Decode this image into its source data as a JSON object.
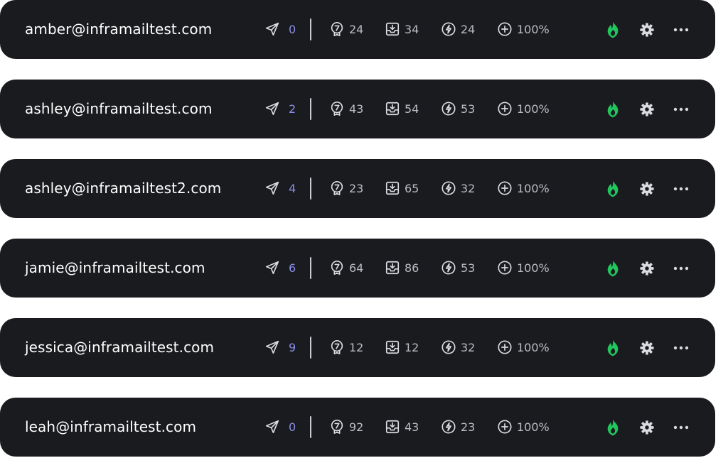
{
  "accounts": [
    {
      "email": "amber@inframailtest.com",
      "sent": "0",
      "ratings": "24",
      "inbox": "34",
      "activity": "24",
      "health": "100%",
      "warmup_status": "active"
    },
    {
      "email": "ashley@inframailtest.com",
      "sent": "2",
      "ratings": "43",
      "inbox": "54",
      "activity": "53",
      "health": "100%",
      "warmup_status": "active"
    },
    {
      "email": "ashley@inframailtest2.com",
      "sent": "4",
      "ratings": "23",
      "inbox": "65",
      "activity": "32",
      "health": "100%",
      "warmup_status": "active"
    },
    {
      "email": "jamie@inframailtest.com",
      "sent": "6",
      "ratings": "64",
      "inbox": "86",
      "activity": "53",
      "health": "100%",
      "warmup_status": "active"
    },
    {
      "email": "jessica@inframailtest.com",
      "sent": "9",
      "ratings": "12",
      "inbox": "12",
      "activity": "32",
      "health": "100%",
      "warmup_status": "active"
    },
    {
      "email": "leah@inframailtest.com",
      "sent": "0",
      "ratings": "92",
      "inbox": "43",
      "activity": "23",
      "health": "100%",
      "warmup_status": "active"
    }
  ],
  "icons": {
    "sent": "paper-plane-icon",
    "ratings": "award-badge-icon",
    "inbox": "inbox-download-icon",
    "activity": "lightning-bolt-icon",
    "health": "plus-circle-icon",
    "warmup": "flame-icon",
    "settings": "gear-icon",
    "more": "more-horizontal-icon"
  },
  "colors": {
    "row_background": "#1a1b1f",
    "email_text": "#ffffff",
    "sent_count": "#8a8fe8",
    "stat_text": "#b9bcc4",
    "flame_active": "#22c55e",
    "icon_stroke": "#d9dbe0"
  }
}
